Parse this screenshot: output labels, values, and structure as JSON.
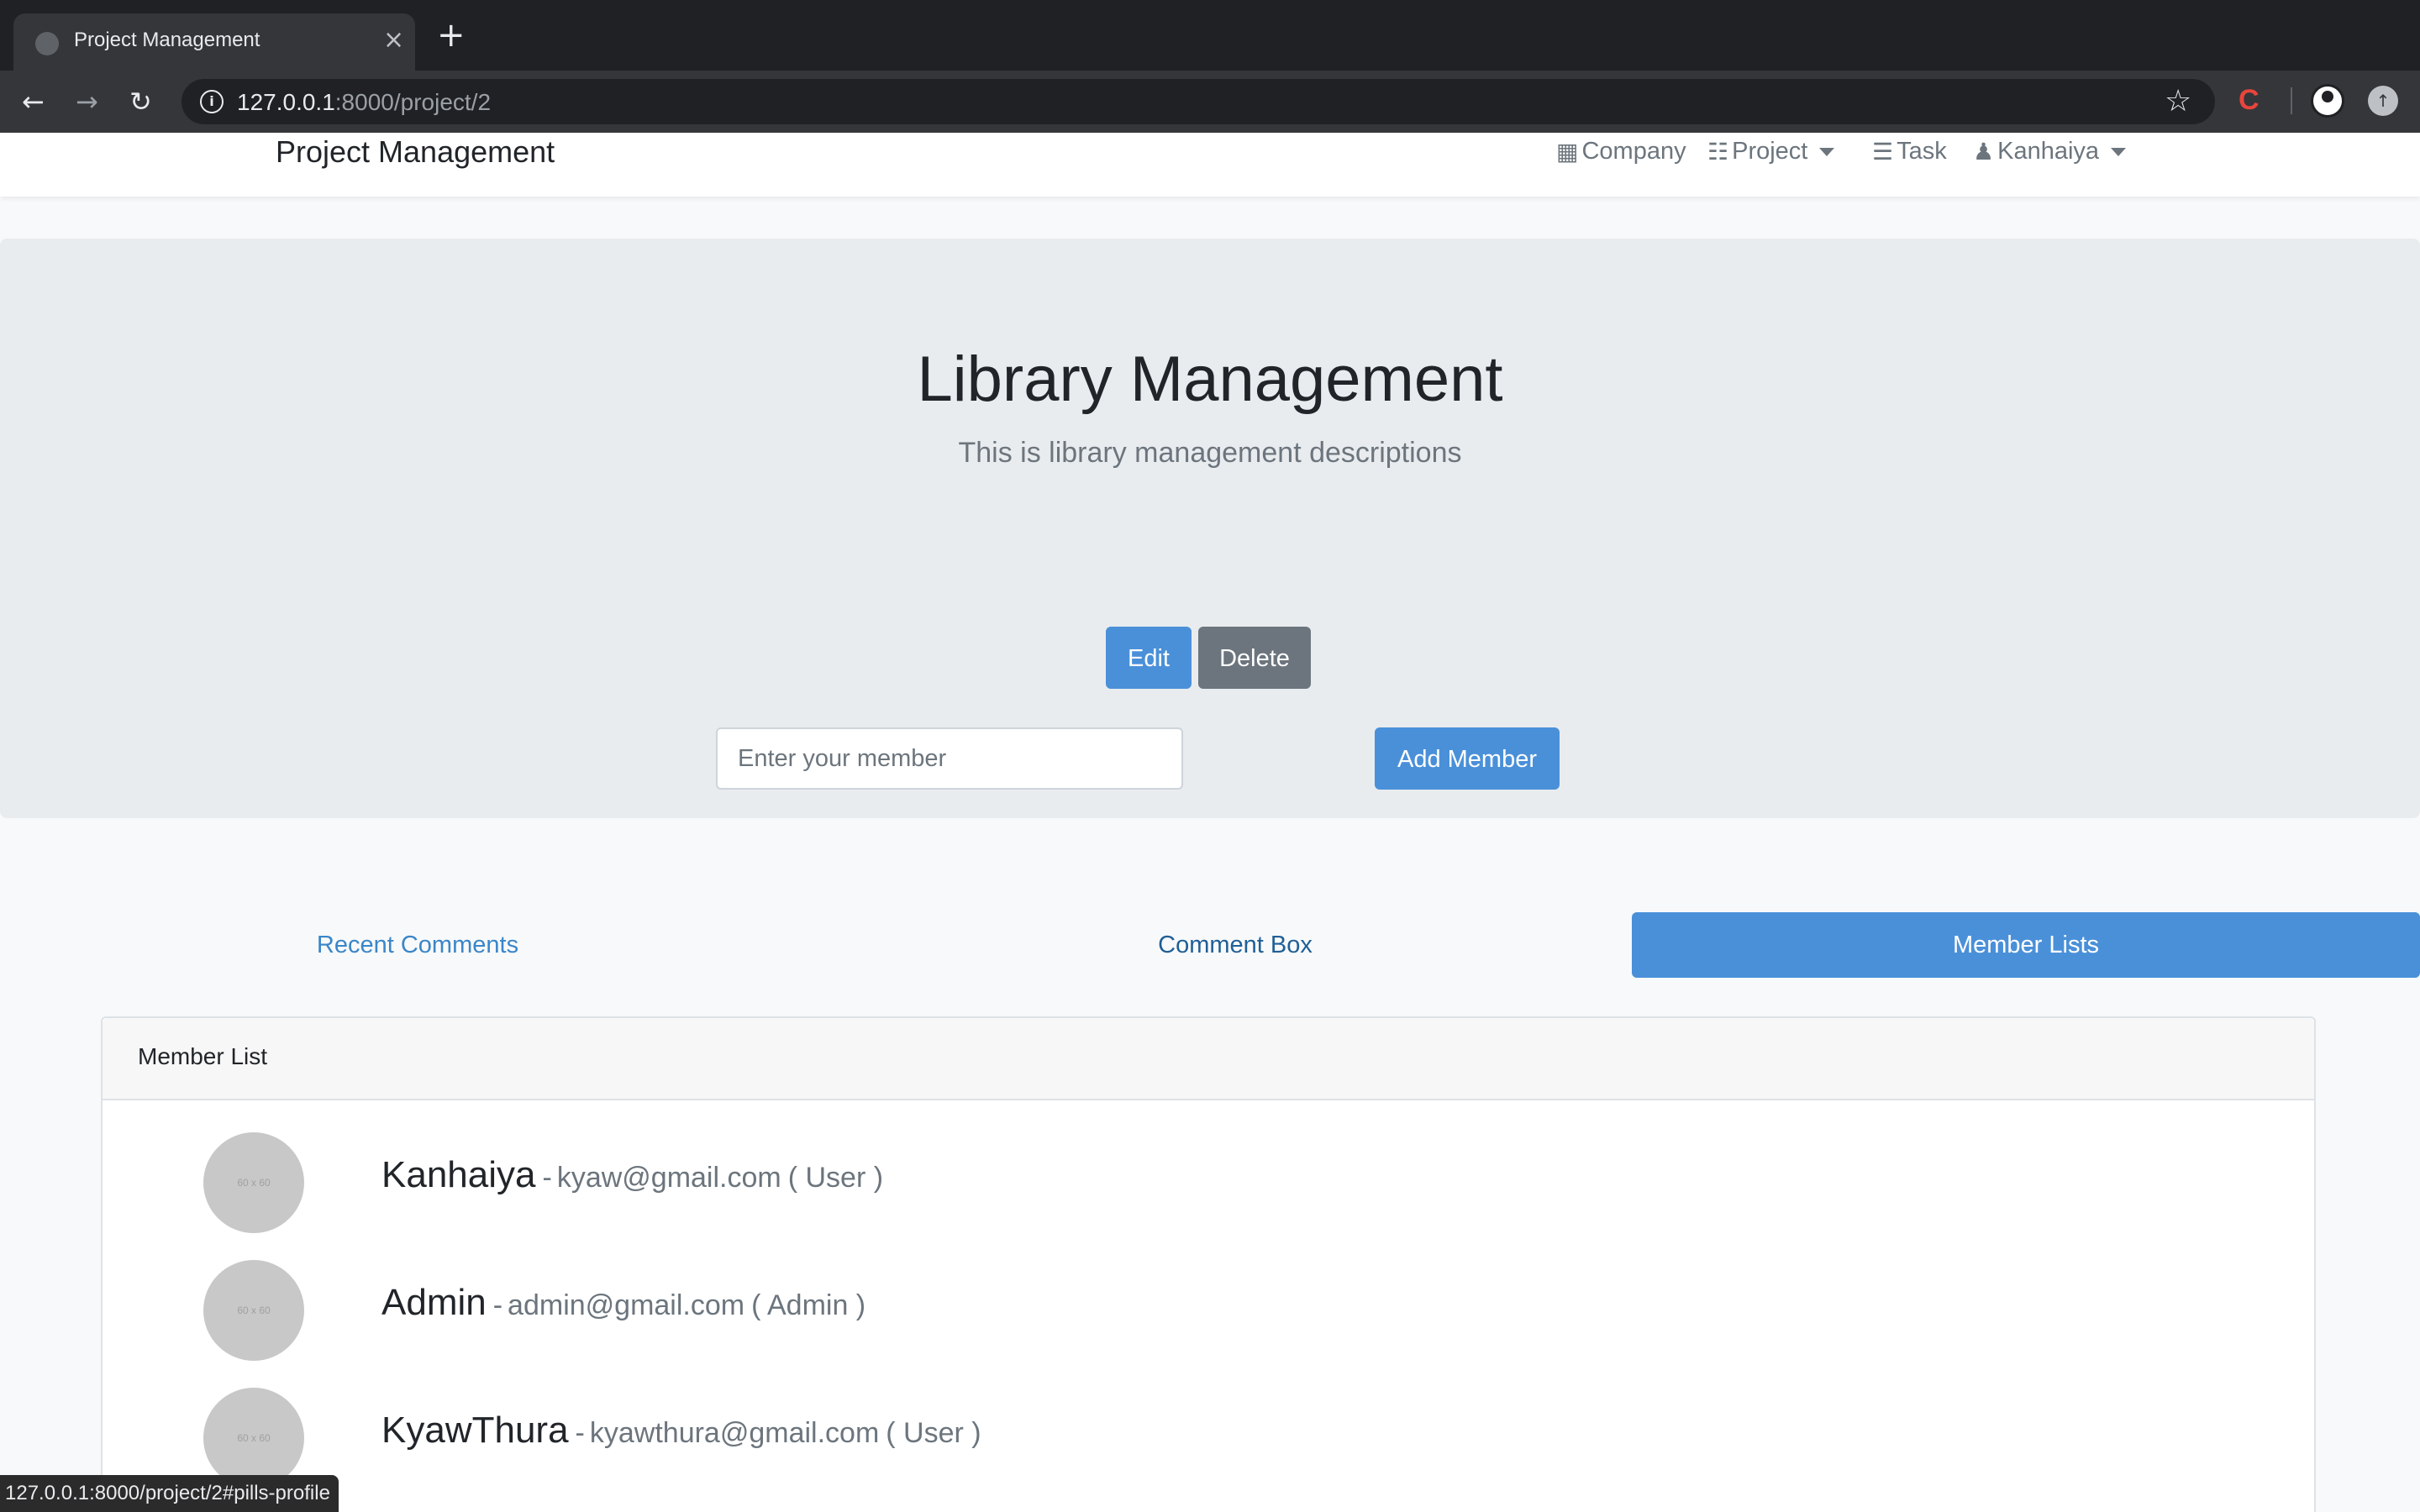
{
  "browser": {
    "tab_title": "Project Management",
    "tab_close": "×",
    "new_tab": "+",
    "url_host": "127.0.0.1",
    "url_path": ":8000/project/2",
    "status_url": "127.0.0.1:8000/project/2#pills-profile",
    "extension_label": "C"
  },
  "navbar": {
    "brand": "Project Management",
    "items": [
      {
        "label": "Company",
        "icon": "building-icon"
      },
      {
        "label": "Project",
        "icon": "sitemap-icon"
      },
      {
        "label": "Task",
        "icon": "tasks-icon"
      },
      {
        "label": "Kanhaiya",
        "icon": "user-secret-icon"
      }
    ]
  },
  "project": {
    "title": "Library Management",
    "description": "This is library management descriptions",
    "edit_label": "Edit",
    "delete_label": "Delete",
    "member_placeholder": "Enter your member",
    "add_member_label": "Add Member"
  },
  "pills": {
    "recent": "Recent Comments",
    "comment_box": "Comment Box",
    "member_lists": "Member Lists",
    "active": "Member Lists"
  },
  "member_list": {
    "header": "Member List",
    "avatar_placeholder": "60 x 60",
    "separator": "-",
    "members": [
      {
        "name": "Kanhaiya",
        "email": "kyaw@gmail.com",
        "role": "( User )"
      },
      {
        "name": "Admin",
        "email": "admin@gmail.com",
        "role": "( Admin )"
      },
      {
        "name": "KyawThura",
        "email": "kyawthura@gmail.com",
        "role": "( User )"
      }
    ]
  },
  "colors": {
    "primary": "#4a90d9",
    "secondary": "#6c757d",
    "jumbotron": "#e9ecef"
  }
}
